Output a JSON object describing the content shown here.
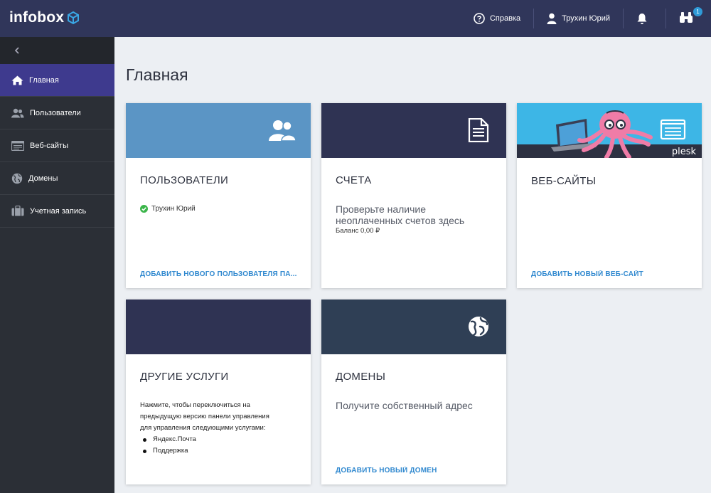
{
  "header": {
    "logo": "infobox",
    "help_label": "Справка",
    "user_name": "Трухин Юрий",
    "notification_count": "1"
  },
  "sidebar": {
    "items": [
      {
        "label": "Главная",
        "icon": "home-icon"
      },
      {
        "label": "Пользователи",
        "icon": "users-icon"
      },
      {
        "label": "Веб-сайты",
        "icon": "websites-icon"
      },
      {
        "label": "Домены",
        "icon": "globe-icon"
      },
      {
        "label": "Учетная запись",
        "icon": "briefcase-icon"
      }
    ]
  },
  "main": {
    "title": "Главная",
    "cards": {
      "users": {
        "title": "ПОЛЬЗОВАТЕЛИ",
        "user": "Трухин Юрий",
        "link": "ДОБАВИТЬ НОВОГО ПОЛЬЗОВАТЕЛЯ ПА..."
      },
      "invoices": {
        "title": "СЧЕТА",
        "text": "Проверьте наличие неоплаченных счетов здесь",
        "balance": "Баланс 0,00 ₽"
      },
      "websites": {
        "title": "ВЕБ-САЙТЫ",
        "link": "ДОБАВИТЬ НОВЫЙ ВЕБ-САЙТ",
        "banner_text": "plesk"
      },
      "other": {
        "title": "ДРУГИЕ УСЛУГИ",
        "text": "Нажмите, чтобы переключиться на предыдущую версию панели управления для управления следующими услугами:",
        "items": [
          "Яндекс.Почта",
          "Поддержка"
        ]
      },
      "domains": {
        "title": "ДОМЕНЫ",
        "text": "Получите собственный адрес",
        "link": "ДОБАВИТЬ НОВЫЙ ДОМЕН"
      }
    }
  },
  "colors": {
    "topbar": "#30365a",
    "sidebar": "#2b2f36",
    "active_nav": "#3e3a8e",
    "users_head": "#5b95c5",
    "invoices_head": "#2f3353",
    "websites_head": "#3db6e6",
    "other_head": "#2f3353",
    "domains_head": "#2f3f55",
    "link": "#2f88cf"
  }
}
